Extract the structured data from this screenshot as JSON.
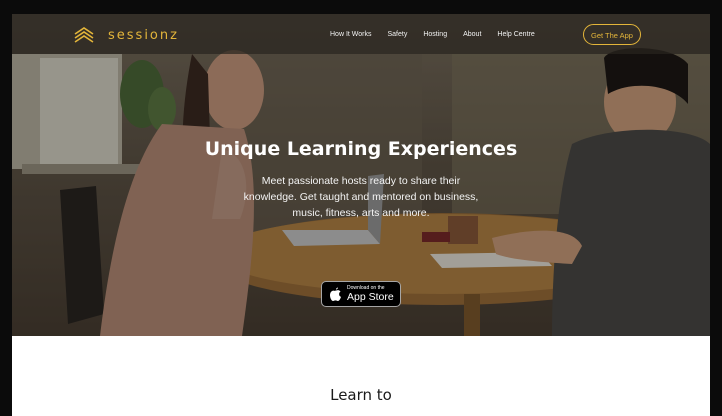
{
  "brand": {
    "name": "sessionz",
    "color": "#e3b53a",
    "icon": "chevron-stack-logo-icon"
  },
  "nav": {
    "items": [
      "How It Works",
      "Safety",
      "Hosting",
      "About",
      "Help Centre"
    ],
    "cta_label": "Get The App"
  },
  "hero": {
    "headline": "Unique Learning Experiences",
    "subtext": "Meet passionate hosts ready to share their knowledge. Get taught and mentored on business, music, fitness, arts and more."
  },
  "app_store": {
    "small": "Download on the",
    "big": "App Store",
    "icon": "apple-icon"
  },
  "section": {
    "title": "Learn to"
  }
}
